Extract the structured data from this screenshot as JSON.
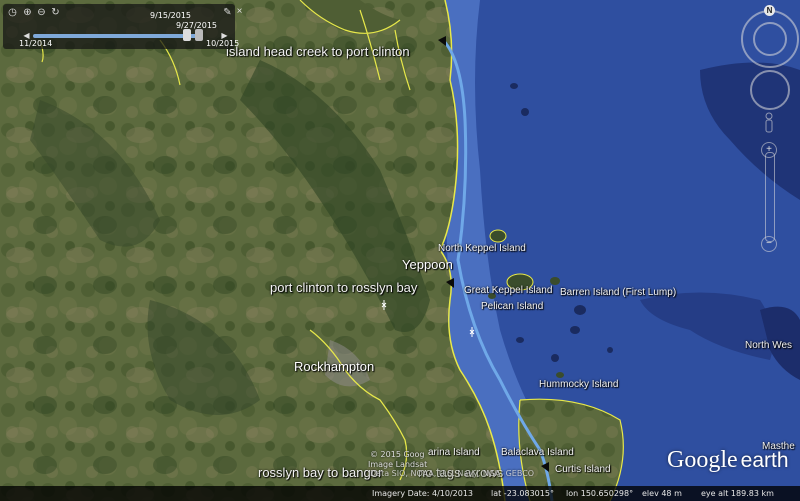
{
  "time_slider": {
    "date_top1": "9/15/2015",
    "date_top2": "9/27/2015",
    "date_start": "11/2014",
    "date_end": "10/2015",
    "icons": [
      "clock-icon",
      "zoom-in-time-icon",
      "zoom-out-time-icon",
      "refresh-time-icon",
      "wrench-icon",
      "close-icon"
    ]
  },
  "route_labels": {
    "route1": "island head creek to port clinton",
    "route2": "port clinton to rosslyn bay",
    "route3": "rosslyn bay to bangor"
  },
  "route3_overlap": "no tags arrows",
  "places": {
    "yeppoon": "Yeppoon",
    "rockhampton": "Rockhampton",
    "north_keppel": "North Keppel Island",
    "great_keppel": "Great Keppel Island",
    "pelican": "Pelican Island",
    "barren": "Barren Island (First Lump)",
    "hummocky": "Hummocky Island",
    "north_west": "North Wes",
    "masthe": "Masthe",
    "curtis": "Curtis Island",
    "balaclava": "Balaclava Island",
    "garina": "arina Island"
  },
  "credits": {
    "line1": "© 2015 Goog",
    "line2": "Image Landsat",
    "line3": "Data SIO, NOAA, U.S. Navy, NGA, GEBCO"
  },
  "status": {
    "imagery": "Imagery Date: 4/10/2013",
    "lat": "lat  -23.083015°",
    "lon": "lon  150.650298°",
    "elev": "elev     48 m",
    "eye": "eye alt 189.83 km"
  },
  "nav": {
    "north_label": "N"
  },
  "logo": {
    "google": "Google",
    "earth": "earth"
  },
  "colors": {
    "ocean": "#2f4fa0",
    "land": "#5a6b3c",
    "coast_line": "#e7e84a",
    "route": "#6fa8e8"
  }
}
